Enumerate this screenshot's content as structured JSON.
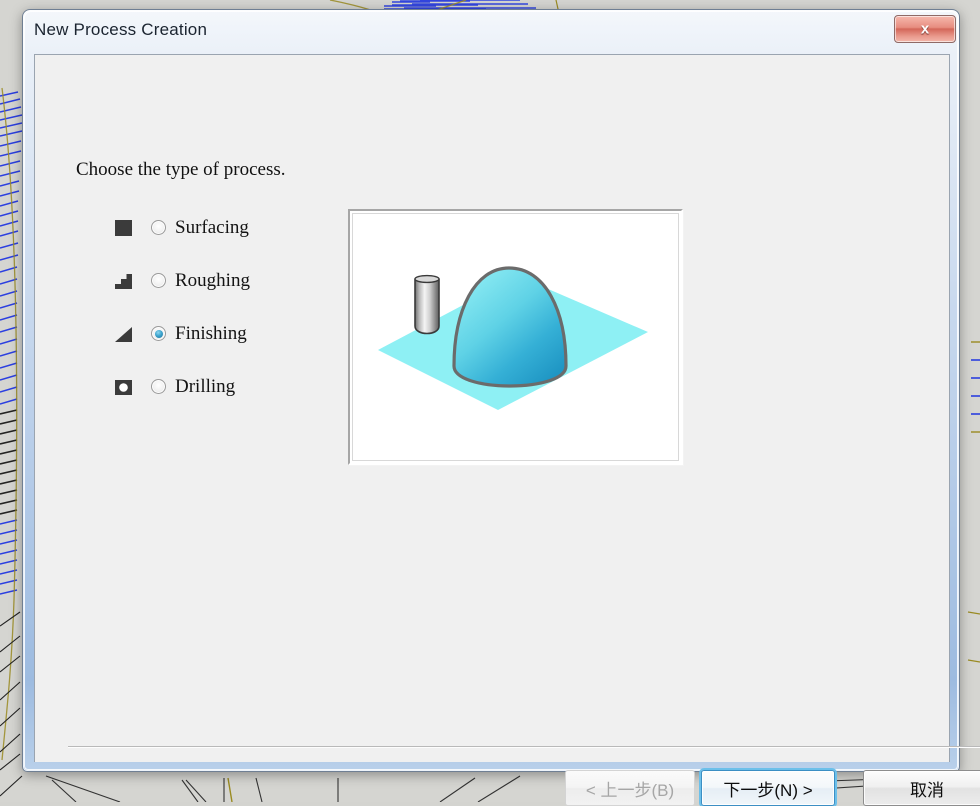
{
  "window": {
    "title": "New Process Creation",
    "close_label": "x",
    "close_icon": "close-x-icon"
  },
  "content": {
    "instruction": "Choose the type of process.",
    "options": [
      {
        "label": "Surfacing",
        "icon": "solid-square-icon",
        "selected": false
      },
      {
        "label": "Roughing",
        "icon": "stair-step-icon",
        "selected": false
      },
      {
        "label": "Finishing",
        "icon": "right-triangle-icon",
        "selected": true
      },
      {
        "label": "Drilling",
        "icon": "square-hole-icon",
        "selected": false
      }
    ],
    "preview": {
      "name": "process-preview-illustration",
      "description": "3D dome on a cyan plane with a cylindrical cutting tool",
      "colors": {
        "plane": "#8ef0f4",
        "dome_light": "#7fe3ee",
        "dome_dark": "#2fa8d0",
        "dome_outline": "#6b6b6b",
        "tool_light": "#f2f2f2",
        "tool_dark": "#6e6e6e",
        "background": "#ffffff"
      }
    }
  },
  "footer": {
    "buttons": [
      {
        "id": "back",
        "label": "< 上一步(B)",
        "state": "disabled"
      },
      {
        "id": "next",
        "label": "下一步(N) >",
        "state": "focused"
      },
      {
        "id": "cancel",
        "label": "取消",
        "state": "normal"
      }
    ]
  },
  "theme": {
    "accent": "#6cc0ea",
    "titlebar_start": "#f4f7fb",
    "titlebar_end": "#9dbbe0",
    "client_bg": "#f0f0f0",
    "close_button": "#d4675a",
    "backdrop_bg": "#d5d5d1",
    "toolpath_blue": "#2b3fe0",
    "toolpath_olive": "#9a8b22",
    "toolpath_dark": "#1a1a1a"
  }
}
